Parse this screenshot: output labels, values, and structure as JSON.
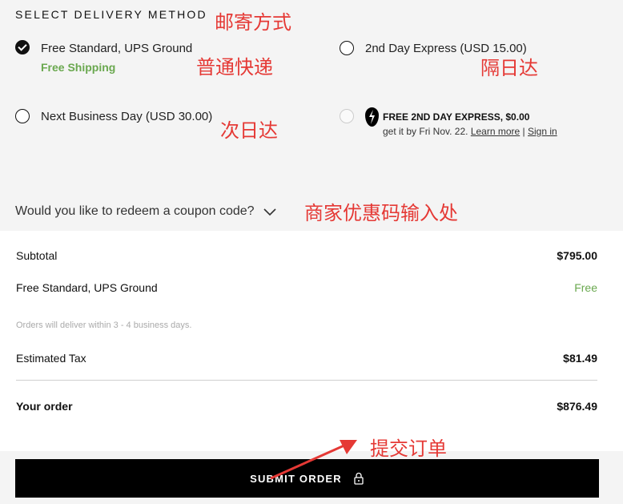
{
  "delivery": {
    "title": "SELECT DELIVERY METHOD",
    "options": [
      {
        "label": "Free Standard, UPS Ground",
        "sublabel": "Free Shipping",
        "selected": true
      },
      {
        "label": "2nd Day Express (USD 15.00)",
        "selected": false
      },
      {
        "label": "Next Business Day (USD 30.00)",
        "selected": false
      },
      {
        "title": "FREE 2ND DAY EXPRESS, $0.00",
        "subtext": "get it by Fri Nov. 22.",
        "learn_more": "Learn more",
        "separator": "|",
        "sign_in": "Sign in",
        "selected": false,
        "disabled": true
      }
    ]
  },
  "coupon": {
    "label": "Would you like to redeem a coupon code?"
  },
  "summary": {
    "subtotal_label": "Subtotal",
    "subtotal_value": "$795.00",
    "shipping_label": "Free Standard, UPS Ground",
    "shipping_value": "Free",
    "delivery_note": "Orders will deliver within 3 - 4 business days.",
    "tax_label": "Estimated Tax",
    "tax_value": "$81.49",
    "total_label": "Your order",
    "total_value": "$876.49"
  },
  "submit": {
    "label": "SUBMIT ORDER",
    "icon": "lock-icon"
  },
  "annotations": {
    "delivery_method": "邮寄方式",
    "standard": "普通快递",
    "second_day": "隔日达",
    "next_day": "次日达",
    "coupon": "商家优惠码输入处",
    "submit": "提交订单"
  },
  "colors": {
    "free_green": "#6aa84f",
    "annotation_red": "#e53935",
    "button_black": "#000000"
  }
}
